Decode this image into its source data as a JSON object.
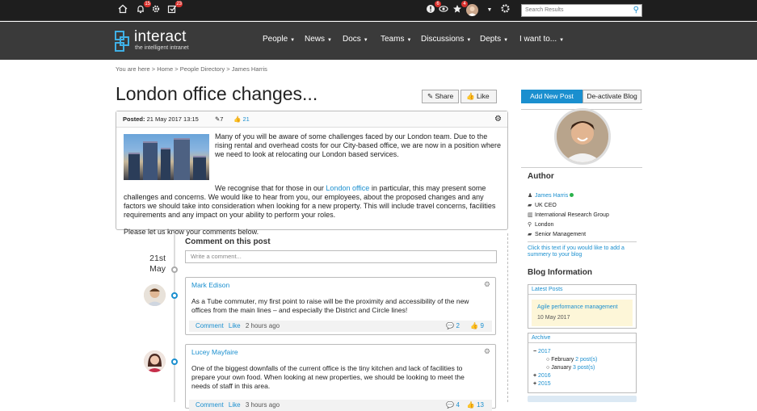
{
  "topbar": {
    "notifications_count": "15",
    "tasks_count": "23",
    "alerts_count": "6",
    "favorites_count": "4",
    "search_placeholder": "Search Results"
  },
  "header": {
    "logo_name": "interact",
    "logo_tagline": "the intelligent intranet",
    "nav": [
      "People",
      "News",
      "Docs",
      "Teams",
      "Discussions",
      "Depts",
      "I want to..."
    ]
  },
  "breadcrumb": "You are here > Home > People Directory > James Harris",
  "page_title": "London office changes...",
  "actions": {
    "share": "Share",
    "like": "Like",
    "add_new_post": "Add New Post",
    "deactivate_blog": "De-activate Blog"
  },
  "post": {
    "posted_label": "Posted:",
    "posted_date": "21 May 2017 13:15",
    "edit_count": "7",
    "likes_count": "21",
    "para1": "Many of you will be aware of some challenges faced by our London team. Due to the rising rental and overhead costs for our City-based office, we are now in a position where we need to look at relocating our London based services.",
    "para2_pre": "We recognise that for those in our ",
    "para2_link": "London office",
    "para2_post": " in particular, this may present some challenges and concerns. We would like to hear from you, our employees, about the proposed changes and any factors we should take into consideration when looking for a new property. This will include travel concerns, facilities requirements and any impact on your ability to perform your roles.",
    "para3": "Please let us know your comments below."
  },
  "comments": {
    "heading": "Comment on this post",
    "placeholder": "Write a comment...",
    "date_day": "21st",
    "date_month": "May",
    "items": [
      {
        "author": "Mark Edison",
        "text": "As a Tube commuter, my first point to raise will be the proximity and accessibility of the new offices from the main lines – and especially the District and Circle lines!",
        "comment_label": "Comment",
        "like_label": "Like",
        "time": "2 hours ago",
        "replies": "2",
        "likes": "9"
      },
      {
        "author": "Lucey Mayfaire",
        "text": "One of the biggest downfalls of the current office is the tiny kitchen and lack of facilities to prepare your own food. When looking at new properties, we should be looking to meet the needs of staff in this area.",
        "comment_label": "Comment",
        "like_label": "Like",
        "time": "3 hours ago",
        "replies": "4",
        "likes": "13"
      }
    ]
  },
  "author": {
    "heading": "Author",
    "name": "James Harris",
    "role": "UK CEO",
    "company": "International Research Group",
    "location": "London",
    "level": "Senior Management",
    "summary_link": "Click this text if you would like to add a summery to your blog"
  },
  "blog_info": {
    "heading": "Blog Information",
    "latest_posts_label": "Latest Posts",
    "latest_post_title": "Agile performance management",
    "latest_post_date": "10 May 2017",
    "archive_label": "Archive",
    "archive_2017": "2017",
    "feb_label": "February",
    "feb_posts": "2 post(s)",
    "jan_label": "January",
    "jan_posts": "3 post(s)",
    "archive_2016": "2016",
    "archive_2015": "2015"
  },
  "colors": {
    "accent": "#1a8fcf",
    "header_bg": "#3a3a3a",
    "topbar_bg": "#1e1e1e",
    "online": "#2bb24c"
  }
}
